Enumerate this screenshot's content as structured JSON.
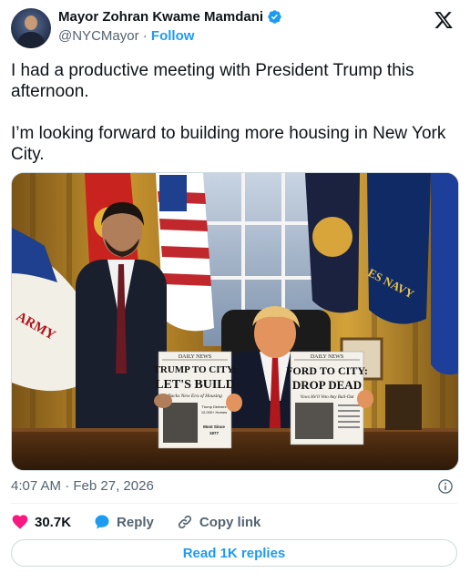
{
  "author": {
    "name": "Mayor Zohran Kwame Mamdani",
    "handle": "@NYCMayor",
    "separator": "·",
    "follow_label": "Follow"
  },
  "icons": {
    "verified": "verified-badge-icon",
    "platform": "x-logo-icon",
    "info": "info-icon",
    "like": "heart-icon",
    "reply": "reply-bubble-icon",
    "copy": "link-icon"
  },
  "tweet": {
    "paragraphs": [
      "I had a productive meeting with President Trump this afternoon.",
      "I’m looking forward to building more housing in New York City."
    ]
  },
  "media": {
    "newspaper_left": {
      "masthead": "DAILY NEWS",
      "headline_1": "TRUMP TO CITY:",
      "headline_2": "LET'S BUILD",
      "subhead": "Backs New Era of Housing",
      "side_1": "Trump Delivers",
      "side_2": "12,000+ Homes",
      "side_3": "Most Since",
      "side_4": "1977"
    },
    "newspaper_right": {
      "masthead": "DAILY NEWS",
      "headline_1": "FORD TO CITY:",
      "headline_2": "DROP DEAD",
      "subhead": "Vows He'll Veto Any Bail-Out"
    },
    "flag_text_left": "ARMY",
    "flag_text_right": "ES NAVY"
  },
  "meta": {
    "time": "4:07 AM",
    "separator": "·",
    "date": "Feb 27, 2026"
  },
  "actions": {
    "likes": "30.7K",
    "reply_label": "Reply",
    "copy_label": "Copy link"
  },
  "replies_button": "Read 1K replies",
  "colors": {
    "accent": "#1d9bf0",
    "like": "#f91880",
    "muted": "#536471",
    "text": "#0f1419"
  }
}
